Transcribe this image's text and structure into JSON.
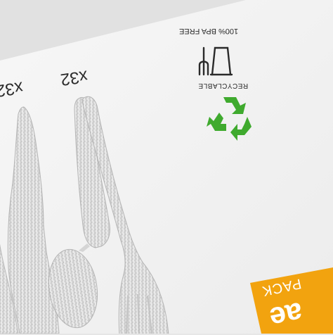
{
  "package": {
    "bpa_free_text": "100% BPA FREE",
    "recyclable_text": "RECYCLABLE",
    "count_knife": "x32",
    "count_spoon": "x32",
    "brand_mark": "ae",
    "brand_word": "PACK",
    "colors": {
      "card": "#f4f4f4",
      "background": "#e2e2e2",
      "recycle_green": "#3faa2e",
      "brand_orange": "#f2a30f",
      "cutlery": "#dcdcdc",
      "sparkle": "#9a9a9a"
    },
    "icons": [
      "cup-and-fork-icon",
      "recycle-icon"
    ]
  }
}
